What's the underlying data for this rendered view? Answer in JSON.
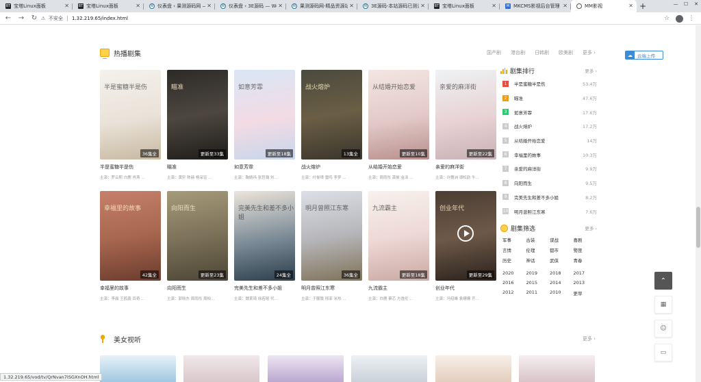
{
  "browser": {
    "tabs": [
      {
        "label": "宝塔Linux面板",
        "favicon": "BT"
      },
      {
        "label": "宝塔Linux面板",
        "favicon": "BT"
      },
      {
        "label": "仪表盘 ‹ 果测源码网 —",
        "favicon": "W"
      },
      {
        "label": "仪表盘 ‹ 3E源码 — Wo",
        "favicon": "W"
      },
      {
        "label": "果测源码网-精品资源站",
        "favicon": "W"
      },
      {
        "label": "3E源码-本站源码已测试",
        "favicon": "W"
      },
      {
        "label": "宝塔Linux面板",
        "favicon": "BT"
      },
      {
        "label": "MKCMS影视后台管理",
        "favicon": "M"
      },
      {
        "label": "MM影视",
        "favicon": ""
      }
    ],
    "new_tab": "+",
    "not_secure": "不安全",
    "url": "1.32.219.65/index.html",
    "status_url": "1.32.219.65/vod/tv/QrNvan7ISGXnOH.html"
  },
  "hot_tv": {
    "title": "热播剧集",
    "links": [
      "国产剧",
      "港台剧",
      "日韩剧",
      "欧美剧"
    ],
    "more": "更多 ›",
    "row1": [
      {
        "name": "半是蜜糖半是伤",
        "cast": "主演：罗云熙 白鹿 肖燕 ...",
        "badge": "36集全",
        "poster_title": "半是蜜糖半是伤"
      },
      {
        "name": "瞄准",
        "cast": "主演：黄轩 陈赫 杨采钰 ...",
        "badge": "更新至33集",
        "poster_title": "瞄准"
      },
      {
        "name": "如意芳霏",
        "cast": "主演：鞠婧祎 张哲瀚 刘...",
        "badge": "更新至18集",
        "poster_title": "如意芳霏"
      },
      {
        "name": "战火熔炉",
        "cast": "主演：付俊璋 雷鸣 李梦 ...",
        "badge": "13集全",
        "poster_title": "战火熔炉"
      },
      {
        "name": "从结婚开始恋爱",
        "cast": "主演：周雨彤 龚俊 金泽 ...",
        "badge": "更新至10集",
        "poster_title": "从结婚开始恋爱"
      },
      {
        "name": "亲爱的麻洋街",
        "cast": "主演：许魏洲 谭松韵 牛...",
        "badge": "更新至22集",
        "poster_title": "亲爱的麻洋街"
      }
    ],
    "row2": [
      {
        "name": "幸福里的故事",
        "cast": "主演：李晨 王鸥鑫 百奇 ...",
        "badge": "42集全",
        "poster_title": "幸福里的故事"
      },
      {
        "name": "向阳而生",
        "cast": "主演：郭晓东 周雨彤 周柏...",
        "badge": "更新至23集",
        "poster_title": "向阳而生"
      },
      {
        "name": "完美先生和差不多小姐",
        "cast": "主演：魏莱琦 徐若晗 代...",
        "badge": "24集全",
        "poster_title": "完美先生和差不多小姐"
      },
      {
        "name": "明月曾照江东寒",
        "cast": "主演：于朦胧 邢菲 米热 ...",
        "badge": "36集全",
        "poster_title": "明月曾照江东寒"
      },
      {
        "name": "九流霸主",
        "cast": "主演：白鹿 蔡芯 方逸伦 ...",
        "badge": "更新至18集",
        "poster_title": "九流霸主"
      },
      {
        "name": "创业年代",
        "cast": "主演：冯绍峰 袁姗姗 齐...",
        "badge": "更新至29集",
        "poster_title": "创业年代"
      }
    ]
  },
  "ranking": {
    "title": "剧集排行",
    "more": "更多 ›",
    "items": [
      {
        "num": "1",
        "title": "半是蜜糖半是伤",
        "value": "53.4万"
      },
      {
        "num": "2",
        "title": "瞄准",
        "value": "47.6万"
      },
      {
        "num": "3",
        "title": "如意芳霏",
        "value": "17.6万"
      },
      {
        "num": "4",
        "title": "战火熔炉",
        "value": "17.2万"
      },
      {
        "num": "5",
        "title": "从结婚开始恋爱",
        "value": "14万"
      },
      {
        "num": "6",
        "title": "幸福里的故事",
        "value": "10.3万"
      },
      {
        "num": "7",
        "title": "亲爱的麻洋街",
        "value": "9.9万"
      },
      {
        "num": "8",
        "title": "向阳而生",
        "value": "9.5万"
      },
      {
        "num": "9",
        "title": "完美先生和差不多小姐",
        "value": "8.2万"
      },
      {
        "num": "10",
        "title": "明月曾照江东寒",
        "value": "7.6万"
      }
    ],
    "top_colors": [
      "#e84c3d",
      "#f39c12",
      "#2ecc71"
    ],
    "other_color": "#cccccc"
  },
  "filter": {
    "title": "剧集筛选",
    "more": "更多 ›",
    "genres": [
      "军事",
      "古装",
      "谍战",
      "喜剧",
      "言情",
      "伦理",
      "都市",
      "警匪",
      "历史",
      "神话",
      "武侠",
      "青春"
    ],
    "years": [
      "2020",
      "2019",
      "2018",
      "2017",
      "2016",
      "2015",
      "2014",
      "2013",
      "2012",
      "2011",
      "2010",
      "更早"
    ]
  },
  "women": {
    "title": "美女视听",
    "more": "更多 ›"
  },
  "upload": {
    "label": "云端上传"
  },
  "float": {
    "top": "⌃",
    "qr": "▦",
    "face": "☺",
    "chat": "▭"
  }
}
